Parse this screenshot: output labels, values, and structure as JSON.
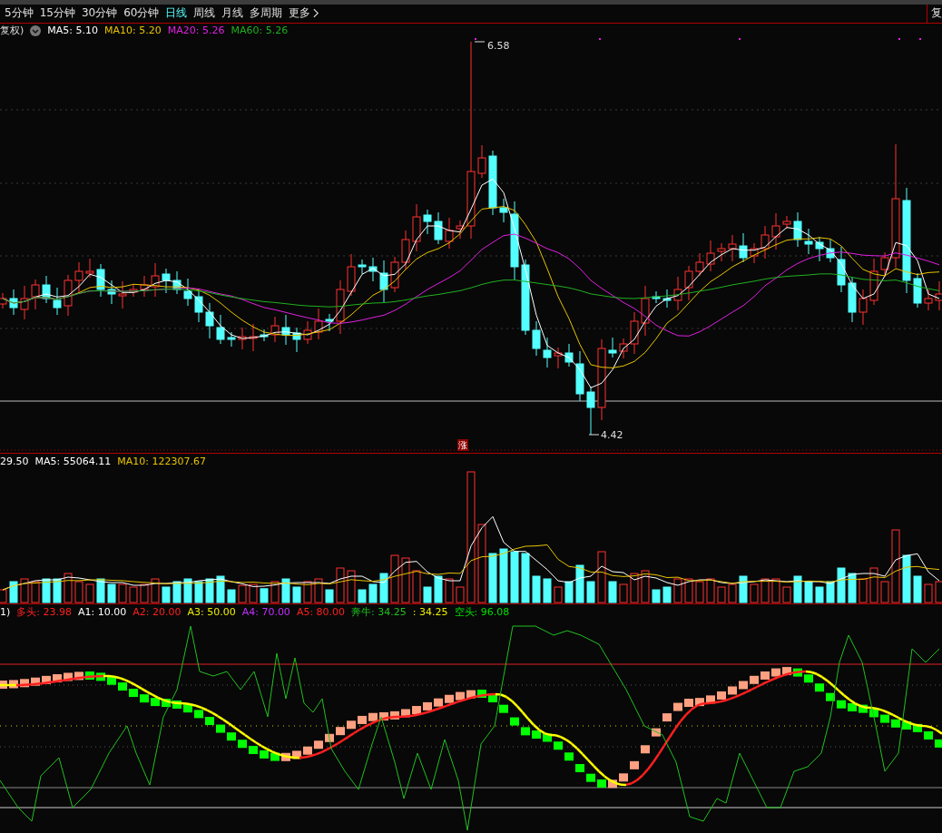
{
  "period_tabs": [
    {
      "label": "5分钟",
      "selected": false
    },
    {
      "label": "15分钟",
      "selected": false
    },
    {
      "label": "30分钟",
      "selected": false
    },
    {
      "label": "60分钟",
      "selected": false
    },
    {
      "label": "日线",
      "selected": true
    },
    {
      "label": "周线",
      "selected": false
    },
    {
      "label": "月线",
      "selected": false
    },
    {
      "label": "多周期",
      "selected": false
    },
    {
      "label": "更多",
      "selected": false
    }
  ],
  "right_button": "复",
  "price_chart": {
    "legend_prefix": "复权)",
    "legend": [
      {
        "label": "MA5: 5.10",
        "color": "#ffffff"
      },
      {
        "label": "MA10: 5.20",
        "color": "#e8c400"
      },
      {
        "label": "MA20: 5.26",
        "color": "#e020e0"
      },
      {
        "label": "MA60: 5.26",
        "color": "#20b020"
      }
    ],
    "high_label": "6.58",
    "low_label": "4.42",
    "badge": "涨"
  },
  "volume_chart": {
    "legend": [
      {
        "label": "29.50",
        "color": "#ffffff"
      },
      {
        "label": "MA5: 55064.11",
        "color": "#ffffff"
      },
      {
        "label": "MA10: 122307.67",
        "color": "#e8c400"
      }
    ]
  },
  "indicator_chart": {
    "legend": [
      {
        "label": "1)",
        "color": "#ffffff"
      },
      {
        "label": "多头: 23.98",
        "color": "#ff2020"
      },
      {
        "label": "A1: 10.00",
        "color": "#ffffff"
      },
      {
        "label": "A2: 20.00",
        "color": "#ff2020"
      },
      {
        "label": "A3: 50.00",
        "color": "#f0f000"
      },
      {
        "label": "A4: 70.00",
        "color": "#c030ff"
      },
      {
        "label": "A5: 80.00",
        "color": "#ff2020"
      },
      {
        "label": "奔牛: 34.25",
        "color": "#20c020"
      },
      {
        "label": ": 34.25",
        "color": "#f0f000"
      },
      {
        "label": "空头: 96.08",
        "color": "#00e000"
      }
    ]
  }
}
